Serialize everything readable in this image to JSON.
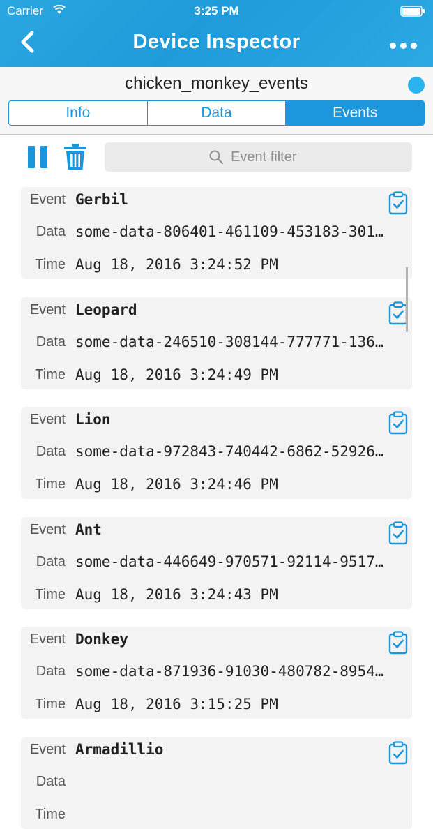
{
  "status_bar": {
    "carrier": "Carrier",
    "time": "3:25 PM"
  },
  "nav": {
    "title": "Device Inspector"
  },
  "device": {
    "name": "chicken_monkey_events",
    "status_color": "#2ab4ee"
  },
  "tabs": [
    {
      "label": "Info",
      "active": false
    },
    {
      "label": "Data",
      "active": false
    },
    {
      "label": "Events",
      "active": true
    }
  ],
  "filter": {
    "placeholder": "Event filter"
  },
  "labels": {
    "event": "Event",
    "data": "Data",
    "time": "Time"
  },
  "events": [
    {
      "name": "Gerbil",
      "data": "some-data-806401-461109-453183-301…",
      "time": "Aug 18, 2016 3:24:52 PM"
    },
    {
      "name": "Leopard",
      "data": "some-data-246510-308144-777771-136…",
      "time": "Aug 18, 2016 3:24:49 PM"
    },
    {
      "name": "Lion",
      "data": "some-data-972843-740442-6862-52926…",
      "time": "Aug 18, 2016 3:24:46 PM"
    },
    {
      "name": "Ant",
      "data": "some-data-446649-970571-92114-9517…",
      "time": "Aug 18, 2016 3:24:43 PM"
    },
    {
      "name": "Donkey",
      "data": "some-data-871936-91030-480782-8954…",
      "time": "Aug 18, 2016 3:15:25 PM"
    },
    {
      "name": "Armadillio",
      "data": "",
      "time": ""
    }
  ],
  "colors": {
    "accent": "#1c97dd",
    "header": "#22a0dd",
    "card": "#f3f3f3"
  },
  "icons": {
    "back": "chevron-left-icon",
    "more": "ellipsis-icon",
    "pause": "pause-icon",
    "trash": "trash-icon",
    "search": "search-icon",
    "copy": "clipboard-check-icon"
  }
}
